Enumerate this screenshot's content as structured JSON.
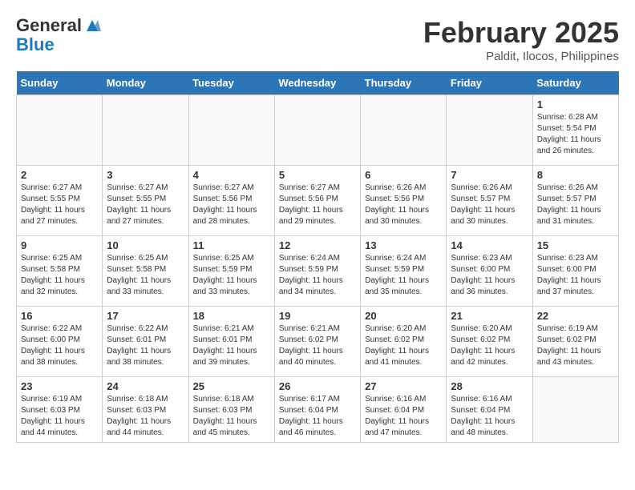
{
  "header": {
    "logo_general": "General",
    "logo_blue": "Blue",
    "month_title": "February 2025",
    "location": "Paldit, Ilocos, Philippines"
  },
  "days_of_week": [
    "Sunday",
    "Monday",
    "Tuesday",
    "Wednesday",
    "Thursday",
    "Friday",
    "Saturday"
  ],
  "weeks": [
    [
      {
        "day": "",
        "info": ""
      },
      {
        "day": "",
        "info": ""
      },
      {
        "day": "",
        "info": ""
      },
      {
        "day": "",
        "info": ""
      },
      {
        "day": "",
        "info": ""
      },
      {
        "day": "",
        "info": ""
      },
      {
        "day": "1",
        "info": "Sunrise: 6:28 AM\nSunset: 5:54 PM\nDaylight: 11 hours\nand 26 minutes."
      }
    ],
    [
      {
        "day": "2",
        "info": "Sunrise: 6:27 AM\nSunset: 5:55 PM\nDaylight: 11 hours\nand 27 minutes."
      },
      {
        "day": "3",
        "info": "Sunrise: 6:27 AM\nSunset: 5:55 PM\nDaylight: 11 hours\nand 27 minutes."
      },
      {
        "day": "4",
        "info": "Sunrise: 6:27 AM\nSunset: 5:56 PM\nDaylight: 11 hours\nand 28 minutes."
      },
      {
        "day": "5",
        "info": "Sunrise: 6:27 AM\nSunset: 5:56 PM\nDaylight: 11 hours\nand 29 minutes."
      },
      {
        "day": "6",
        "info": "Sunrise: 6:26 AM\nSunset: 5:56 PM\nDaylight: 11 hours\nand 30 minutes."
      },
      {
        "day": "7",
        "info": "Sunrise: 6:26 AM\nSunset: 5:57 PM\nDaylight: 11 hours\nand 30 minutes."
      },
      {
        "day": "8",
        "info": "Sunrise: 6:26 AM\nSunset: 5:57 PM\nDaylight: 11 hours\nand 31 minutes."
      }
    ],
    [
      {
        "day": "9",
        "info": "Sunrise: 6:25 AM\nSunset: 5:58 PM\nDaylight: 11 hours\nand 32 minutes."
      },
      {
        "day": "10",
        "info": "Sunrise: 6:25 AM\nSunset: 5:58 PM\nDaylight: 11 hours\nand 33 minutes."
      },
      {
        "day": "11",
        "info": "Sunrise: 6:25 AM\nSunset: 5:59 PM\nDaylight: 11 hours\nand 33 minutes."
      },
      {
        "day": "12",
        "info": "Sunrise: 6:24 AM\nSunset: 5:59 PM\nDaylight: 11 hours\nand 34 minutes."
      },
      {
        "day": "13",
        "info": "Sunrise: 6:24 AM\nSunset: 5:59 PM\nDaylight: 11 hours\nand 35 minutes."
      },
      {
        "day": "14",
        "info": "Sunrise: 6:23 AM\nSunset: 6:00 PM\nDaylight: 11 hours\nand 36 minutes."
      },
      {
        "day": "15",
        "info": "Sunrise: 6:23 AM\nSunset: 6:00 PM\nDaylight: 11 hours\nand 37 minutes."
      }
    ],
    [
      {
        "day": "16",
        "info": "Sunrise: 6:22 AM\nSunset: 6:00 PM\nDaylight: 11 hours\nand 38 minutes."
      },
      {
        "day": "17",
        "info": "Sunrise: 6:22 AM\nSunset: 6:01 PM\nDaylight: 11 hours\nand 38 minutes."
      },
      {
        "day": "18",
        "info": "Sunrise: 6:21 AM\nSunset: 6:01 PM\nDaylight: 11 hours\nand 39 minutes."
      },
      {
        "day": "19",
        "info": "Sunrise: 6:21 AM\nSunset: 6:02 PM\nDaylight: 11 hours\nand 40 minutes."
      },
      {
        "day": "20",
        "info": "Sunrise: 6:20 AM\nSunset: 6:02 PM\nDaylight: 11 hours\nand 41 minutes."
      },
      {
        "day": "21",
        "info": "Sunrise: 6:20 AM\nSunset: 6:02 PM\nDaylight: 11 hours\nand 42 minutes."
      },
      {
        "day": "22",
        "info": "Sunrise: 6:19 AM\nSunset: 6:02 PM\nDaylight: 11 hours\nand 43 minutes."
      }
    ],
    [
      {
        "day": "23",
        "info": "Sunrise: 6:19 AM\nSunset: 6:03 PM\nDaylight: 11 hours\nand 44 minutes."
      },
      {
        "day": "24",
        "info": "Sunrise: 6:18 AM\nSunset: 6:03 PM\nDaylight: 11 hours\nand 44 minutes."
      },
      {
        "day": "25",
        "info": "Sunrise: 6:18 AM\nSunset: 6:03 PM\nDaylight: 11 hours\nand 45 minutes."
      },
      {
        "day": "26",
        "info": "Sunrise: 6:17 AM\nSunset: 6:04 PM\nDaylight: 11 hours\nand 46 minutes."
      },
      {
        "day": "27",
        "info": "Sunrise: 6:16 AM\nSunset: 6:04 PM\nDaylight: 11 hours\nand 47 minutes."
      },
      {
        "day": "28",
        "info": "Sunrise: 6:16 AM\nSunset: 6:04 PM\nDaylight: 11 hours\nand 48 minutes."
      },
      {
        "day": "",
        "info": ""
      }
    ]
  ]
}
